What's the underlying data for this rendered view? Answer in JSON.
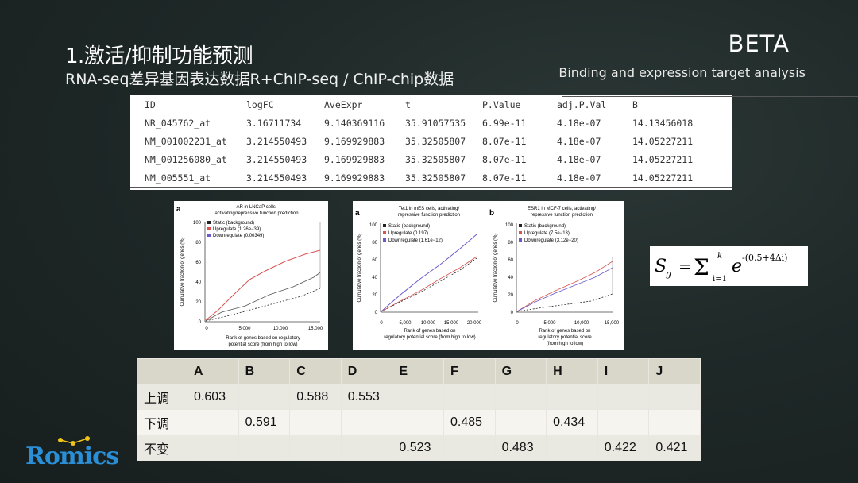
{
  "header": {
    "title": "1.激活/抑制功能预测",
    "subtitle": "RNA-seq差异基因表达数据R+ChIP-seq / ChIP-chip数据",
    "brand": "BETA",
    "brand_subtitle": "Binding and expression target analysis"
  },
  "results_table": {
    "columns": [
      "ID",
      "logFC",
      "AveExpr",
      "t",
      "P.Value",
      "adj.P.Val",
      "B"
    ],
    "rows": [
      [
        "NR_045762_at",
        "3.16711734",
        "9.140369116",
        "35.91057535",
        "6.99e-11",
        "4.18e-07",
        "14.13456018"
      ],
      [
        "NM_001002231_at",
        "3.214550493",
        "9.169929883",
        "35.32505807",
        "8.07e-11",
        "4.18e-07",
        "14.05227211"
      ],
      [
        "NM_001256080_at",
        "3.214550493",
        "9.169929883",
        "35.32505807",
        "8.07e-11",
        "4.18e-07",
        "14.05227211"
      ],
      [
        "NM_005551_at",
        "3.214550493",
        "9.169929883",
        "35.32505807",
        "8.07e-11",
        "4.18e-07",
        "14.05227211"
      ]
    ]
  },
  "charts": {
    "left": {
      "panel_letter": "a",
      "title_line1": "AR in LNCaP cells,",
      "title_line2": "activating/repressive function prediction",
      "ylabel": "Cumulative fraction of genes (%)",
      "xlabel_line1": "Rank of genes based on regulatory",
      "xlabel_line2": "potential score (from high to low)",
      "legend": [
        "Static (background)",
        "Upregulate (1.26e−39)",
        "Downregulate (0.00349)"
      ],
      "yticks": [
        "0",
        "20",
        "40",
        "60",
        "80",
        "100"
      ],
      "xticks": [
        "0",
        "5,000",
        "10,000",
        "15,000"
      ]
    },
    "middle": {
      "panel_letter": "a",
      "title_line1": "Tet1 in mES cells, activating/",
      "title_line2": "repressive function prediction",
      "ylabel": "Cumulative fraction of genes (%)",
      "xlabel_line1": "Rank of genes based on",
      "xlabel_line2": "regulatory potential score (from high to low)",
      "legend": [
        "Static (background)",
        "Upregulate (0.197)",
        "Downregulate (1.61e−12)"
      ],
      "yticks": [
        "0",
        "20",
        "40",
        "60",
        "80",
        "100"
      ],
      "xticks": [
        "0",
        "5,000",
        "10,000",
        "15,000",
        "20,000"
      ]
    },
    "right": {
      "panel_letter": "b",
      "title_line1": "ESR1 in MCF-7 cells, activating/",
      "title_line2": "repressive function prediction",
      "ylabel": "Cumulative fraction of genes (%)",
      "xlabel_line1": "Rank of genes based on",
      "xlabel_line2": "regulatory potential score",
      "xlabel_line3": "(from high to low)",
      "legend": [
        "Static (background)",
        "Upregulate (7.5e−13)",
        "Downregulate (3.12e−20)"
      ],
      "yticks": [
        "0",
        "20",
        "40",
        "60",
        "80",
        "100"
      ],
      "xticks": [
        "0",
        "5,000",
        "10,000",
        "15,000"
      ]
    }
  },
  "formula": {
    "lhs": "S",
    "lhs_sub": "g",
    "equals": "=",
    "sum_upper": "k",
    "sum_lower": "i=1",
    "base": "e",
    "exponent": "-(0.5+4Δi)"
  },
  "grid": {
    "headers": [
      "",
      "A",
      "B",
      "C",
      "D",
      "E",
      "F",
      "G",
      "H",
      "I",
      "J"
    ],
    "rows": [
      [
        "上调",
        "0.603",
        "",
        "0.588",
        "0.553",
        "",
        "",
        "",
        "",
        "",
        ""
      ],
      [
        "下调",
        "",
        "0.591",
        "",
        "",
        "",
        "0.485",
        "",
        "0.434",
        "",
        ""
      ],
      [
        "不变",
        "",
        "",
        "",
        "",
        "0.523",
        "",
        "0.483",
        "",
        "0.422",
        "0.421"
      ]
    ]
  },
  "logo": {
    "text": "Romics"
  },
  "colors": {
    "upregulate": "#d9534f",
    "downregulate": "#6a5acd",
    "static": "#222222"
  }
}
